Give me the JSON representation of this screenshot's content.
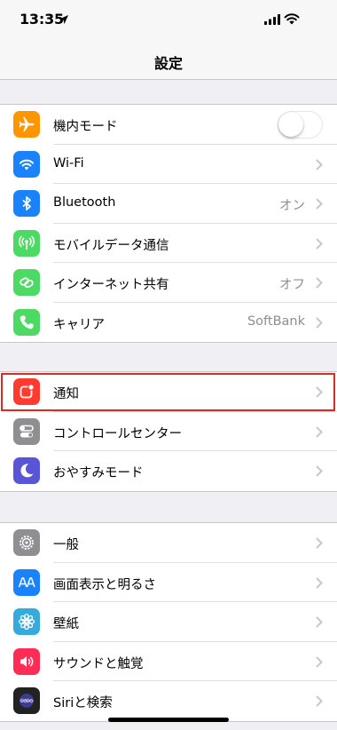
{
  "status_bar": {
    "time": "13:35"
  },
  "nav": {
    "title": "設定"
  },
  "groups": [
    {
      "items": [
        {
          "label": "機内モード",
          "icon": "airplane-icon",
          "color": "#ff9500",
          "control": "toggle",
          "toggle_on": false
        },
        {
          "label": "Wi-Fi",
          "icon": "wifi-icon",
          "color": "#1a82fb",
          "value": ""
        },
        {
          "label": "Bluetooth",
          "icon": "bluetooth-icon",
          "color": "#1a82fb",
          "value": "オン"
        },
        {
          "label": "モバイルデータ通信",
          "icon": "cellular-icon",
          "color": "#4cd964",
          "value": ""
        },
        {
          "label": "インターネット共有",
          "icon": "hotspot-icon",
          "color": "#4cd964",
          "value": "オフ"
        },
        {
          "label": "キャリア",
          "icon": "phone-icon",
          "color": "#4cd964",
          "value": "SoftBank"
        }
      ]
    },
    {
      "items": [
        {
          "label": "通知",
          "icon": "notifications-icon",
          "color": "#ff3b30",
          "value": "",
          "highlighted": true
        },
        {
          "label": "コントロールセンター",
          "icon": "control-center-icon",
          "color": "#8e8e93",
          "value": ""
        },
        {
          "label": "おやすみモード",
          "icon": "moon-icon",
          "color": "#5856d6",
          "value": ""
        }
      ]
    },
    {
      "items": [
        {
          "label": "一般",
          "icon": "gear-icon",
          "color": "#8e8e93",
          "value": ""
        },
        {
          "label": "画面表示と明るさ",
          "icon": "display-brightness-icon",
          "color": "#1a82fb",
          "value": ""
        },
        {
          "label": "壁紙",
          "icon": "wallpaper-icon",
          "color": "#35aadc",
          "value": ""
        },
        {
          "label": "サウンドと触覚",
          "icon": "speaker-icon",
          "color": "#ff2d55",
          "value": ""
        },
        {
          "label": "Siriと検索",
          "icon": "siri-icon",
          "color": "#222222",
          "value": ""
        }
      ]
    }
  ]
}
